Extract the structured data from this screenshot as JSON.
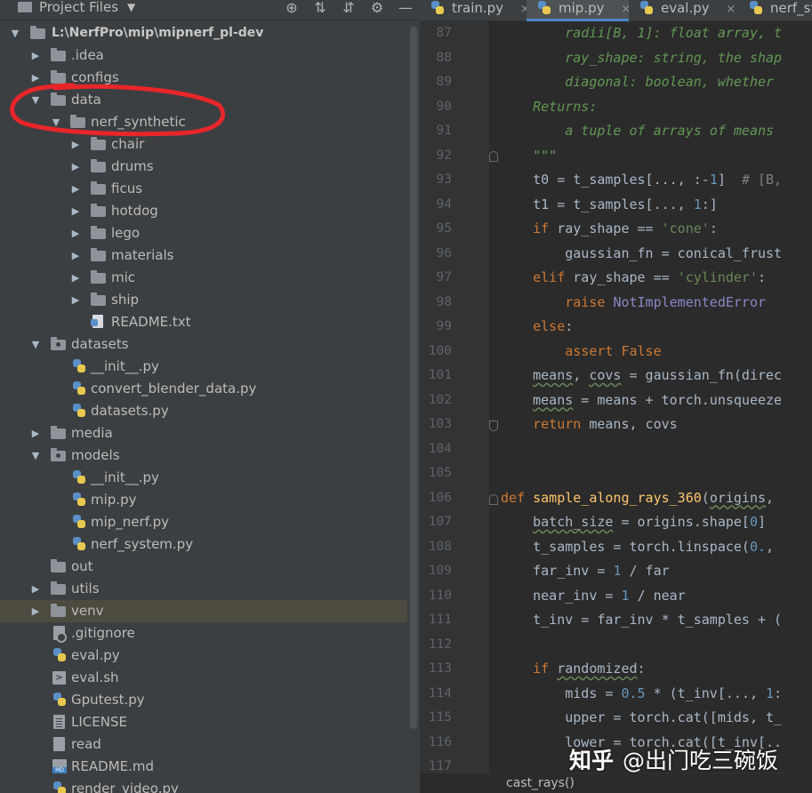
{
  "project_panel": {
    "title": "Project Files",
    "caret": "▼",
    "tools": [
      "⊕",
      "⇅",
      "⇵",
      "⚙",
      "—"
    ],
    "tree": [
      {
        "label": "L:\\NerfPro\\mip\\mipnerf_pl-dev",
        "expanded": true
      },
      {
        "label": ".idea",
        "expanded": false
      },
      {
        "label": "configs",
        "expanded": false
      },
      {
        "label": "data",
        "expanded": true
      },
      {
        "label": "nerf_synthetic",
        "expanded": true
      },
      {
        "label": "chair",
        "expanded": false
      },
      {
        "label": "drums",
        "expanded": false
      },
      {
        "label": "ficus",
        "expanded": false
      },
      {
        "label": "hotdog",
        "expanded": false
      },
      {
        "label": "lego",
        "expanded": false
      },
      {
        "label": "materials",
        "expanded": false
      },
      {
        "label": "mic",
        "expanded": false
      },
      {
        "label": "ship",
        "expanded": false
      },
      {
        "label": "README.txt"
      },
      {
        "label": "datasets",
        "expanded": true
      },
      {
        "label": "__init__.py"
      },
      {
        "label": "convert_blender_data.py"
      },
      {
        "label": "datasets.py"
      },
      {
        "label": "media",
        "expanded": false
      },
      {
        "label": "models",
        "expanded": true
      },
      {
        "label": "__init__.py"
      },
      {
        "label": "mip.py"
      },
      {
        "label": "mip_nerf.py"
      },
      {
        "label": "nerf_system.py"
      },
      {
        "label": "out"
      },
      {
        "label": "utils",
        "expanded": false
      },
      {
        "label": "venv",
        "expanded": false,
        "selected": true
      },
      {
        "label": ".gitignore"
      },
      {
        "label": "eval.py"
      },
      {
        "label": "eval.sh"
      },
      {
        "label": "Gputest.py"
      },
      {
        "label": "LICENSE"
      },
      {
        "label": "read"
      },
      {
        "label": "README.md"
      },
      {
        "label": "render_video.py"
      }
    ]
  },
  "editor": {
    "tabs": [
      {
        "label": "train.py",
        "active": false
      },
      {
        "label": "mip.py",
        "active": true
      },
      {
        "label": "eval.py",
        "active": false
      },
      {
        "label": "nerf_syst",
        "active": false
      }
    ],
    "tab_close": "×",
    "line_numbers": [
      "87",
      "88",
      "89",
      "90",
      "91",
      "92",
      "93",
      "94",
      "95",
      "96",
      "97",
      "98",
      "99",
      "100",
      "101",
      "102",
      "103",
      "104",
      "105",
      "106",
      "107",
      "108",
      "109",
      "110",
      "111",
      "112",
      "113",
      "114",
      "115",
      "116",
      "117"
    ],
    "breadcrumb": "cast_rays()"
  },
  "watermark": {
    "logo": "知乎",
    "handle": "@出门吃三碗饭"
  },
  "colors": {
    "keyword": "#cc7832",
    "string": "#6a8759",
    "number": "#6897bb",
    "docstring": "#629755",
    "annotation": "#e8262a"
  }
}
